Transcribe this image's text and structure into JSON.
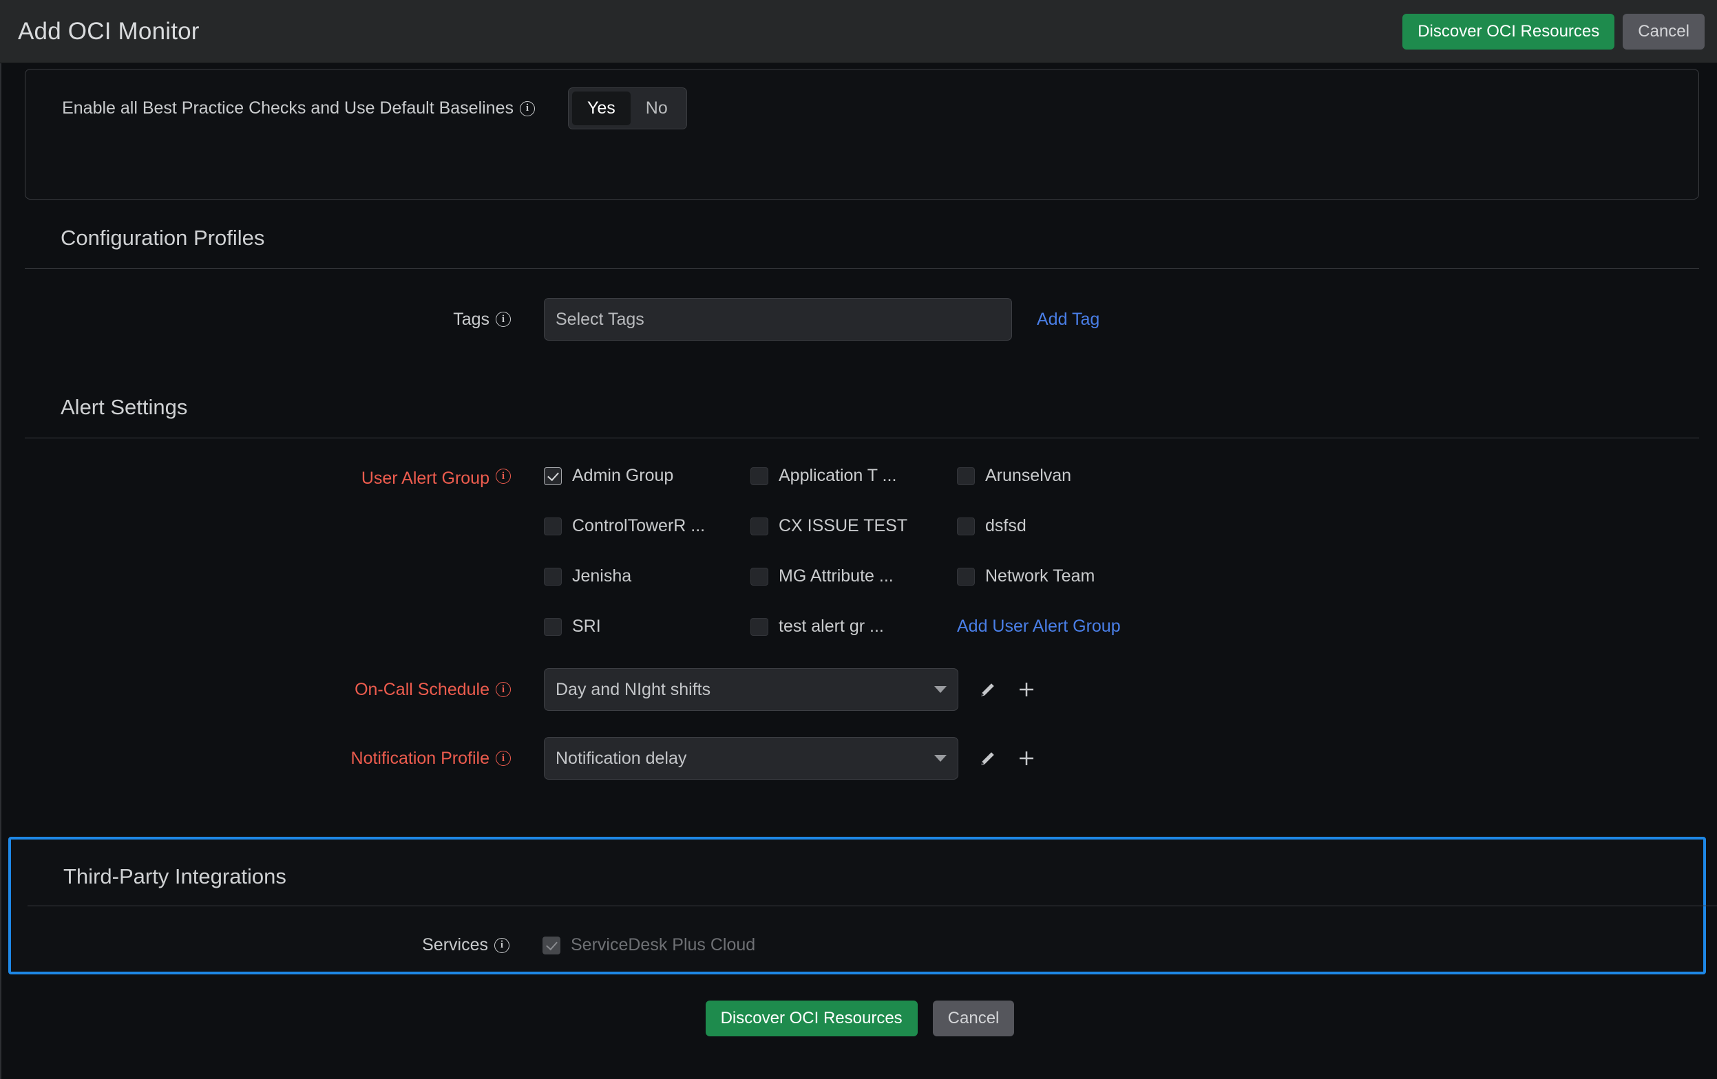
{
  "header": {
    "title": "Add OCI Monitor",
    "discover_label": "Discover OCI Resources",
    "cancel_label": "Cancel"
  },
  "best_practice": {
    "label": "Enable all Best Practice Checks and Use Default Baselines",
    "info_icon": "info-icon",
    "options": [
      "Yes",
      "No"
    ],
    "selected": "Yes"
  },
  "configuration_profiles": {
    "section_title": "Configuration Profiles",
    "tags": {
      "label": "Tags",
      "info_icon": "info-icon",
      "placeholder": "Select Tags",
      "value": "",
      "add_tag_label": "Add Tag"
    }
  },
  "alert_settings": {
    "section_title": "Alert Settings",
    "user_alert_group": {
      "label": "User Alert Group",
      "info_icon": "info-icon",
      "required": true,
      "items": [
        {
          "label": "Admin Group",
          "checked": true
        },
        {
          "label": "Application T ...",
          "checked": false
        },
        {
          "label": "Arunselvan",
          "checked": false
        },
        {
          "label": "ControlTowerR ...",
          "checked": false
        },
        {
          "label": "CX ISSUE TEST",
          "checked": false
        },
        {
          "label": "dsfsd",
          "checked": false
        },
        {
          "label": "Jenisha",
          "checked": false
        },
        {
          "label": "MG Attribute ...",
          "checked": false
        },
        {
          "label": "Network Team",
          "checked": false
        },
        {
          "label": "SRI",
          "checked": false
        },
        {
          "label": "test alert gr ...",
          "checked": false
        }
      ],
      "add_link_label": "Add User Alert Group"
    },
    "on_call_schedule": {
      "label": "On-Call Schedule",
      "info_icon": "info-icon",
      "required": true,
      "value": "Day and NIght shifts",
      "edit_icon": "pencil-icon",
      "add_icon": "plus-icon"
    },
    "notification_profile": {
      "label": "Notification Profile",
      "info_icon": "info-icon",
      "required": true,
      "value": "Notification delay",
      "edit_icon": "pencil-icon",
      "add_icon": "plus-icon"
    }
  },
  "third_party_integrations": {
    "section_title": "Third-Party Integrations",
    "highlighted": true,
    "services": {
      "label": "Services",
      "info_icon": "info-icon",
      "items": [
        {
          "label": "ServiceDesk Plus Cloud",
          "checked": true,
          "disabled": true
        }
      ]
    }
  },
  "footer": {
    "discover_label": "Discover OCI Resources",
    "cancel_label": "Cancel"
  },
  "colors": {
    "accent_green": "#1e8b4d",
    "accent_blue": "#1e87e5",
    "link_blue": "#4a7fe8",
    "required_red": "#ed5c4e",
    "background": "#0d0f12",
    "titlebar": "#262829"
  }
}
